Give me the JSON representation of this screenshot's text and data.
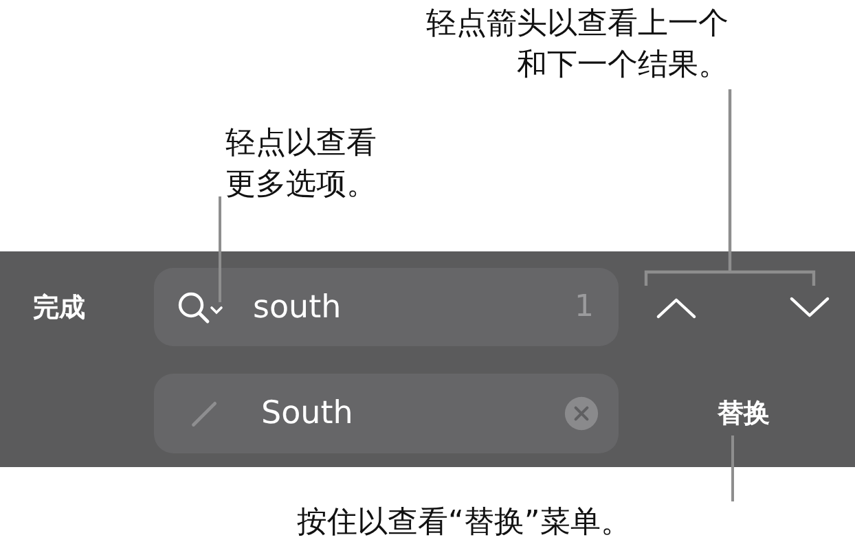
{
  "callouts": [
    {
      "kind": "arrows",
      "text": "轻点箭头以查看上一个和下一个结果。"
    },
    {
      "kind": "options",
      "text": "轻点以查看更多选项。"
    },
    {
      "kind": "replace",
      "text": "按住以查看“替换”菜单。"
    }
  ],
  "find_bar": {
    "done_label": "完成",
    "search": {
      "value": "south",
      "match_count": "1"
    },
    "replace": {
      "value": "South"
    },
    "replace_button": "替换"
  }
}
